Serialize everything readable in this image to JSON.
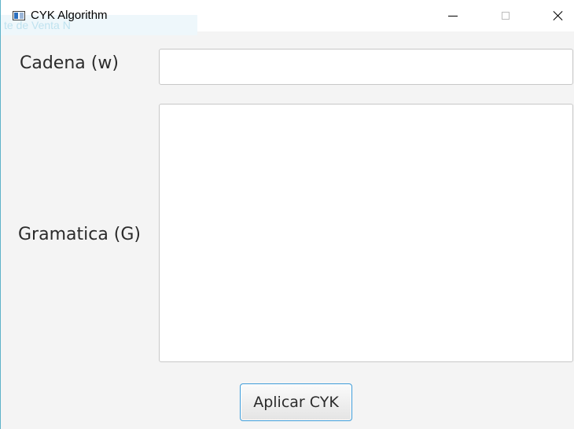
{
  "window": {
    "title": "CYK Algorithm",
    "ghost_text": "te de Venta N",
    "accent_color": "#3d9bd8"
  },
  "form": {
    "cadena_label": "Cadena (w)",
    "cadena_value": "",
    "gramatica_label": "Gramatica (G)",
    "gramatica_value": "",
    "submit_label": "Aplicar CYK"
  },
  "icons": {
    "app": "app-window-icon",
    "minimize": "minimize-icon",
    "maximize": "maximize-icon",
    "close": "close-icon"
  }
}
